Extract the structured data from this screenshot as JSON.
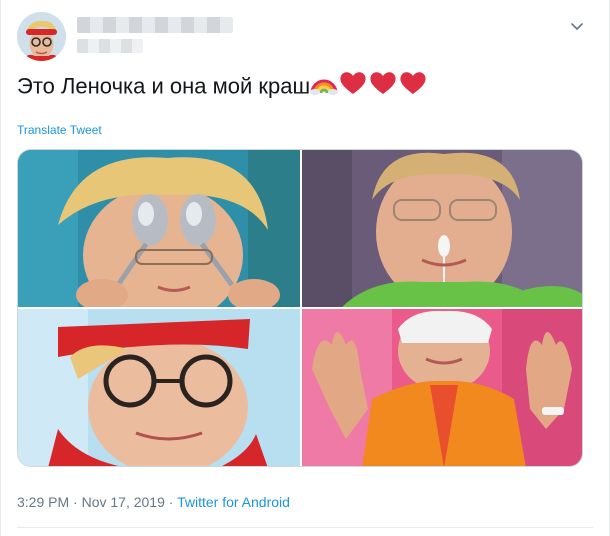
{
  "tweet": {
    "text": "Это Леночка и она мой краш",
    "emoji": [
      "rainbow",
      "red-heart",
      "red-heart",
      "red-heart"
    ],
    "translate_label": "Translate Tweet",
    "time": "3:29 PM",
    "separator": "·",
    "date": "Nov 17, 2019",
    "source": "Twitter for Android"
  },
  "header": {
    "menu_icon": "chevron-down-icon"
  },
  "media": {
    "photos": [
      "photo-spoons",
      "photo-nose-stick",
      "photo-red-bandana",
      "photo-eye-mask"
    ]
  },
  "colors": {
    "link": "#1b95e0",
    "meta": "#657786",
    "text": "#14171a",
    "heart": "#e0245e"
  }
}
